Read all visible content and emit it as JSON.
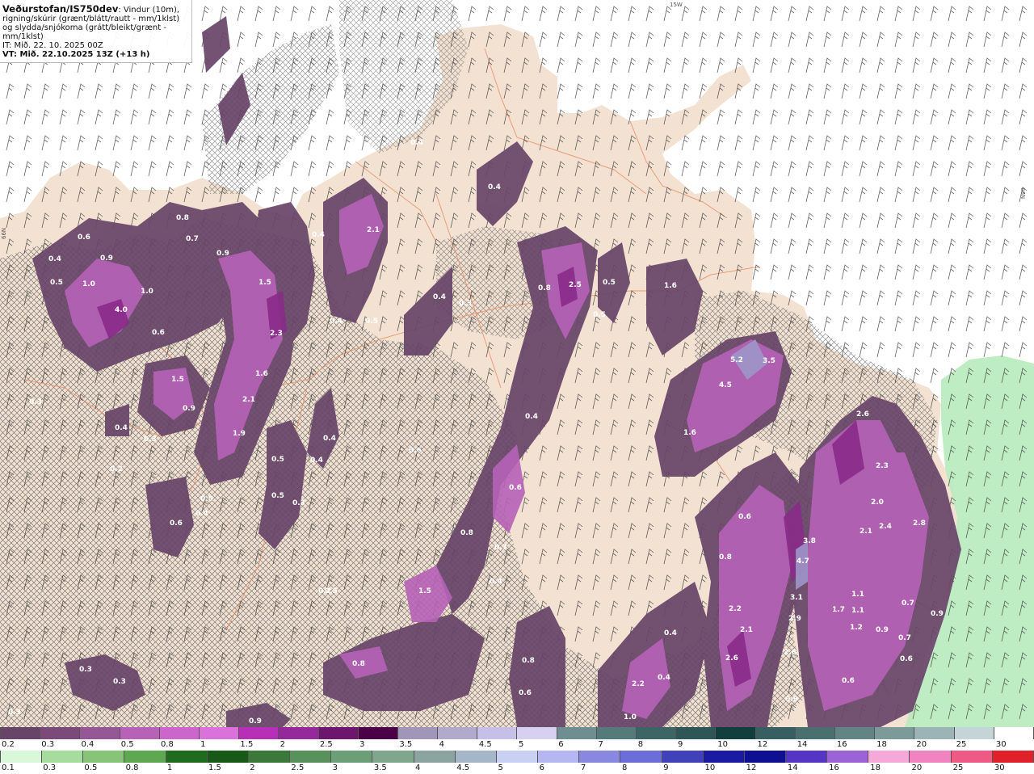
{
  "header": {
    "brand": "Veðurstofan/IS750dev",
    "desc": ": Vindur (10m), rigning/skúrir (grænt/blátt/rautt - mm/1klst) og slydda/snjókoma (grátt/bleikt/grænt - mm/1klst)",
    "it_line": "IT: Mið. 22. 10. 2025 00Z",
    "vt_line": "VT: Mið. 22.10.2025 13Z (+13 h)"
  },
  "grid_labels": {
    "top": "15W",
    "left": "66N",
    "right": "66N"
  },
  "colors": {
    "land": "#f3e2d2",
    "sea": "#ffffff",
    "road": "#e8906a",
    "precip_fill": "#b62fb6"
  },
  "map_labels": [
    "0.6",
    "0.4",
    "0.5",
    "0.9",
    "1.0",
    "1.0",
    "4.0",
    "0.8",
    "0.7",
    "0.9",
    "1.5",
    "2.3",
    "1.6",
    "2.1",
    "1.9",
    "0.5",
    "0.5",
    "0.4",
    "0.5",
    "0.6",
    "0.3",
    "0.4",
    "1.5",
    "0.9",
    "0.6",
    "0.3",
    "0.2",
    "0.3",
    "0.4",
    "0.5",
    "0.4",
    "0.4",
    "2.1",
    "0.4",
    "0.5",
    "0.4",
    "0.4",
    "0.4",
    "0.3",
    "0.8",
    "2.5",
    "0.5",
    "0.5",
    "1.6",
    "0.6",
    "0.4",
    "0.6",
    "0.8",
    "0.7",
    "0.4",
    "0.2",
    "1.5",
    "0.8",
    "0.6",
    "0.8",
    "0.3",
    "0.3",
    "0.3",
    "5.2",
    "4.5",
    "3.5",
    "1.6",
    "2.6",
    "2.3",
    "2.0",
    "2.1",
    "2.4",
    "2.8",
    "0.6",
    "0.8",
    "3.8",
    "4.7",
    "3.1",
    "2.9",
    "2.6",
    "2.2",
    "2.1",
    "2.6",
    "1.7",
    "1.1",
    "1.1",
    "1.2",
    "0.9",
    "0.7",
    "0.9",
    "0.7",
    "0.6",
    "0.6",
    "0.9",
    "0.4",
    "0.4",
    "2.2",
    "1.0",
    "0.9"
  ],
  "legend_top": {
    "labels": [
      "0.2",
      "0.3",
      "0.4",
      "0.5",
      "0.8",
      "1",
      "1.5",
      "2",
      "2.5",
      "3",
      "3.5",
      "4",
      "4.5",
      "5",
      "6",
      "7",
      "8",
      "9",
      "10",
      "12",
      "14",
      "16",
      "18",
      "20",
      "25",
      "30"
    ],
    "colors": [
      "#684468",
      "#7b4a7b",
      "#955795",
      "#b762b7",
      "#cc66cc",
      "#db72db",
      "#b62fb6",
      "#95299b",
      "#6e156e",
      "#4b0048",
      "#a196b9",
      "#b2aacd",
      "#c6c0e8",
      "#d7d1f1",
      "#6e8e92",
      "#557a7a",
      "#3e6565",
      "#2e5656",
      "#133e3e",
      "#375e60",
      "#496f6f",
      "#628484",
      "#7d9a9b",
      "#9cb4b6",
      "#c5d5d7",
      "#ffffff"
    ]
  },
  "legend_bot": {
    "labels": [
      "0.1",
      "0.3",
      "0.5",
      "0.8",
      "1",
      "1.5",
      "2",
      "2.5",
      "3",
      "3.5",
      "4",
      "4.5",
      "5",
      "6",
      "7",
      "8",
      "9",
      "10",
      "12",
      "14",
      "16",
      "18",
      "20",
      "25",
      "30"
    ],
    "colors": [
      "#d9f7d9",
      "#a7dc9f",
      "#86c477",
      "#5ea851",
      "#206c1e",
      "#175a17",
      "#3a793a",
      "#59915a",
      "#6c9e77",
      "#7ea78b",
      "#8ba4a0",
      "#a4b6c7",
      "#c8d0f4",
      "#b4b7f2",
      "#8888e0",
      "#6d6dd7",
      "#4141ba",
      "#1a1aa3",
      "#0f0f92",
      "#5536c4",
      "#9b63d6",
      "#f4a9d9",
      "#f083c0",
      "#ee5a84",
      "#e1212a"
    ]
  }
}
